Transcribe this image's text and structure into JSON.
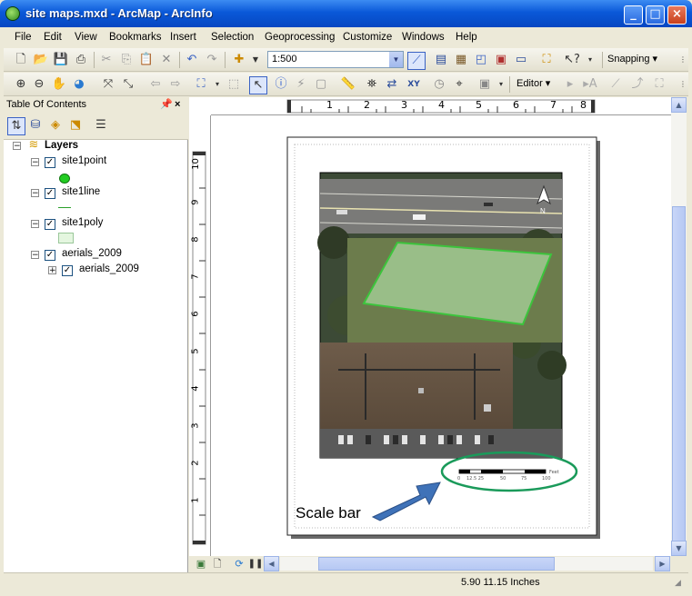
{
  "window": {
    "title": "site maps.mxd - ArcMap - ArcInfo",
    "buttons": {
      "minimize": "_",
      "maximize": "□",
      "close": "×"
    }
  },
  "menu": [
    "File",
    "Edit",
    "View",
    "Bookmarks",
    "Insert",
    "Selection",
    "Geoprocessing",
    "Customize",
    "Windows",
    "Help"
  ],
  "toolbar": {
    "scale_value": "1:500",
    "snapping_label": "Snapping",
    "editor_label": "Editor"
  },
  "toc": {
    "title": "Table Of Contents",
    "root": "Layers",
    "layers": [
      {
        "name": "site1point",
        "checked": true,
        "symbol": "green-point"
      },
      {
        "name": "site1line",
        "checked": true,
        "symbol": "green-line"
      },
      {
        "name": "site1poly",
        "checked": true,
        "symbol": "light-green-fill"
      },
      {
        "name": "aerials_2009",
        "checked": true,
        "sublayer": "aerials_2009"
      }
    ]
  },
  "ruler": {
    "top_labels": [
      "1",
      "2",
      "3",
      "4",
      "5",
      "6",
      "7",
      "8"
    ],
    "left_labels": [
      "10",
      "9",
      "8",
      "7",
      "6",
      "5",
      "4",
      "3",
      "2",
      "1"
    ]
  },
  "map": {
    "north_label": "N",
    "scale_bar_labels": [
      "0",
      "12.5 25",
      "50",
      "75",
      "100"
    ],
    "scale_bar_unit": "Feet"
  },
  "annotation": {
    "callout_text": "Scale bar"
  },
  "status": {
    "coordinates": "5.90  11.15 Inches"
  },
  "colors": {
    "titlebar": "#0a58d8",
    "polygon_stroke": "#3cc43c",
    "callout_ellipse": "#1a9a5a",
    "arrow_fill": "#3f72b8"
  }
}
